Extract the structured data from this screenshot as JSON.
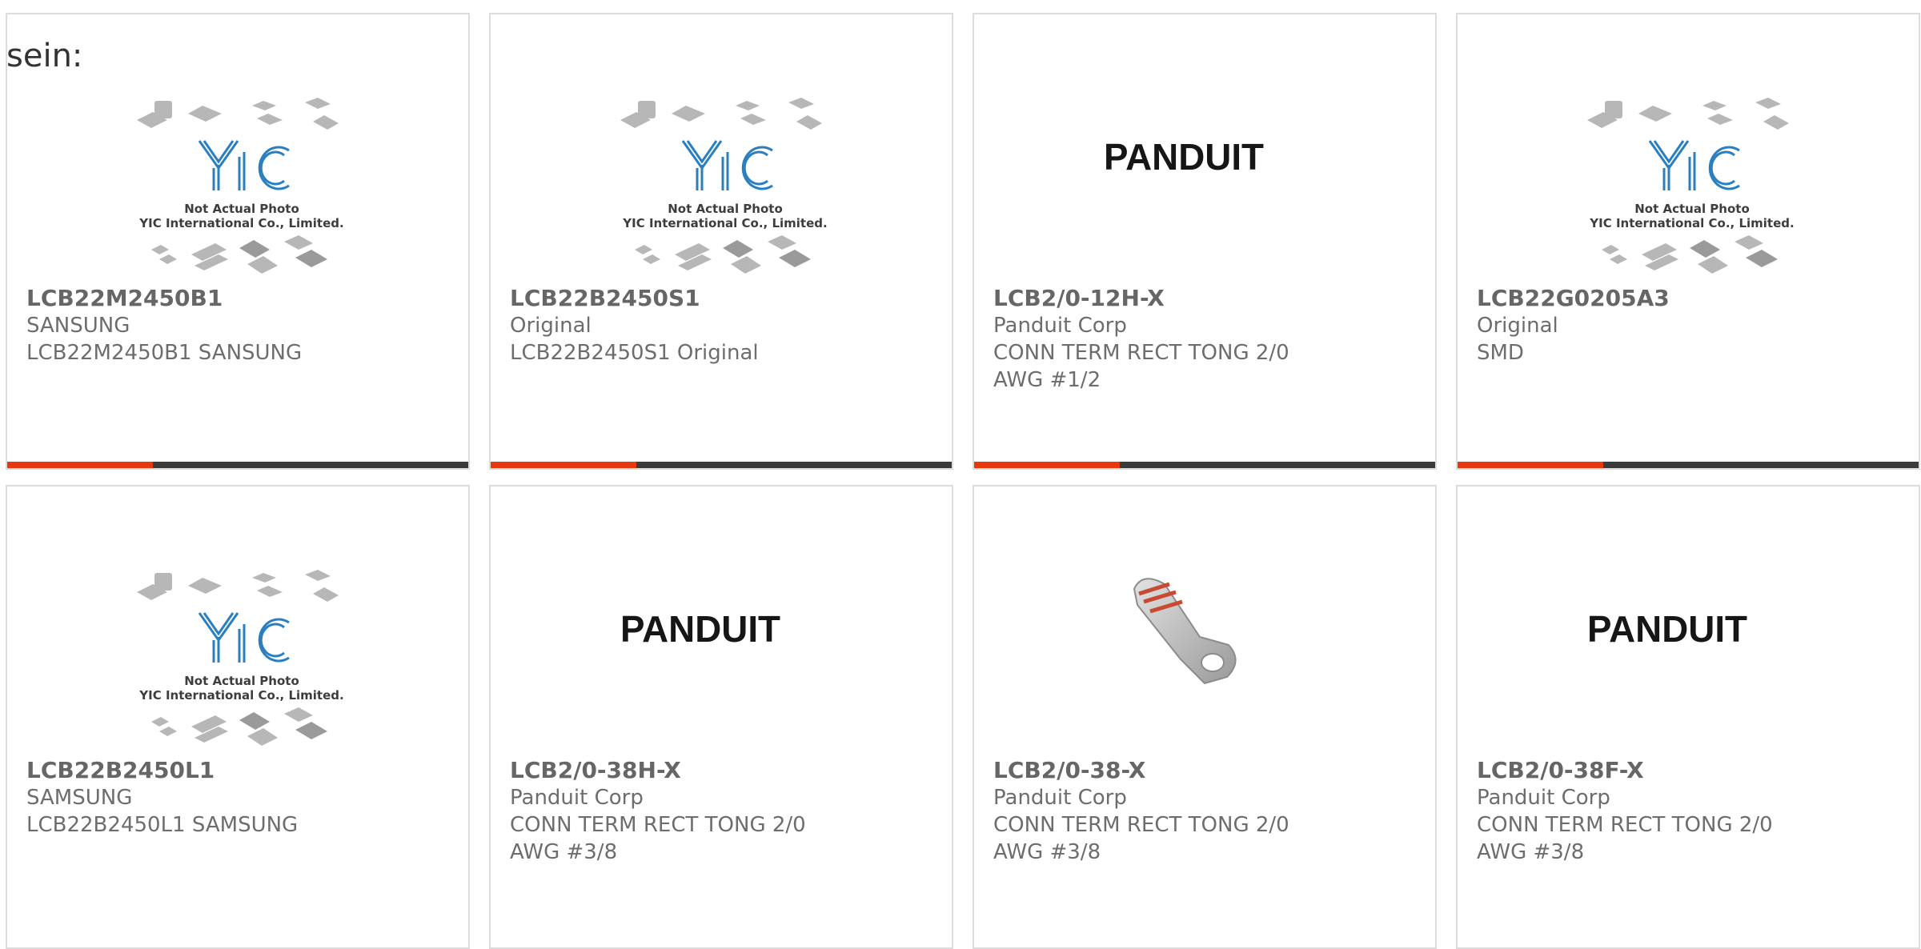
{
  "heading": "sein:",
  "placeholder_caption": {
    "line1": "Not Actual Photo",
    "line2": "YIC International Co., Limited."
  },
  "brand_logo": "PANDUIT",
  "colors": {
    "accent": "#e8380f",
    "bar": "#3b3b3b",
    "border": "#dcdcdc",
    "yic_blue": "#2a7fc1"
  },
  "products": [
    {
      "part_number": "LCB22M2450B1",
      "maker": "SANSUNG",
      "description": "LCB22M2450B1 SANSUNG",
      "image": "yic-placeholder"
    },
    {
      "part_number": "LCB22B2450S1",
      "maker": "Original",
      "description": "LCB22B2450S1 Original",
      "image": "yic-placeholder"
    },
    {
      "part_number": "LCB2/0-12H-X",
      "maker": "Panduit Corp",
      "description": "CONN TERM RECT TONG 2/0 AWG #1/2",
      "image": "panduit-logo"
    },
    {
      "part_number": "LCB22G0205A3",
      "maker": "Original",
      "description": "SMD",
      "image": "yic-placeholder"
    },
    {
      "part_number": "LCB22B2450L1",
      "maker": "SAMSUNG",
      "description": "LCB22B2450L1 SAMSUNG",
      "image": "yic-placeholder"
    },
    {
      "part_number": "LCB2/0-38H-X",
      "maker": "Panduit Corp",
      "description": "CONN TERM RECT TONG 2/0 AWG #3/8",
      "image": "panduit-logo"
    },
    {
      "part_number": "LCB2/0-38-X",
      "maker": "Panduit Corp",
      "description": "CONN TERM RECT TONG 2/0 AWG #3/8",
      "image": "lug-terminal-photo"
    },
    {
      "part_number": "LCB2/0-38F-X",
      "maker": "Panduit Corp",
      "description": "CONN TERM RECT TONG 2/0 AWG #3/8",
      "image": "panduit-logo"
    }
  ]
}
